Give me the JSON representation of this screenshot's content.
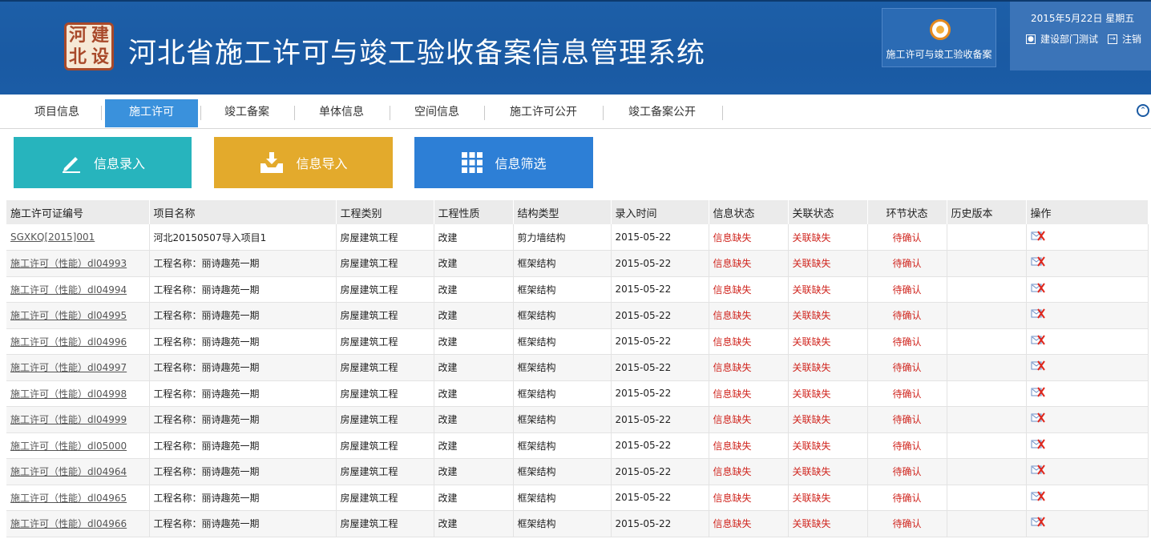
{
  "header": {
    "logo_seal_chars": [
      "河",
      "建",
      "北",
      "设"
    ],
    "title": "河北省施工许可与竣工验收备案信息管理系统",
    "module_label": "施工许可与竣工验收备案",
    "date": "2015年5月22日 星期五",
    "user": "建设部门测试",
    "logout": "注销"
  },
  "nav": {
    "items": [
      "项目信息",
      "施工许可",
      "竣工备案",
      "单体信息",
      "空间信息",
      "施工许可公开",
      "竣工备案公开"
    ],
    "active_index": 1
  },
  "actions": {
    "entry": "信息录入",
    "import": "信息导入",
    "filter": "信息筛选"
  },
  "table": {
    "headers": [
      "施工许可证编号",
      "项目名称",
      "工程类别",
      "工程性质",
      "结构类型",
      "录入时间",
      "信息状态",
      "关联状态",
      "环节状态",
      "历史版本",
      "操作"
    ],
    "rows": [
      [
        "SGXKQ[2015]001",
        "河北20150507导入项目1",
        "房屋建筑工程",
        "改建",
        "剪力墙结构",
        "2015-05-22",
        "信息缺失",
        "关联缺失",
        "待确认",
        ""
      ],
      [
        "施工许可（性能）dl04993",
        "工程名称：丽诗趣苑一期",
        "房屋建筑工程",
        "改建",
        "框架结构",
        "2015-05-22",
        "信息缺失",
        "关联缺失",
        "待确认",
        ""
      ],
      [
        "施工许可（性能）dl04994",
        "工程名称：丽诗趣苑一期",
        "房屋建筑工程",
        "改建",
        "框架结构",
        "2015-05-22",
        "信息缺失",
        "关联缺失",
        "待确认",
        ""
      ],
      [
        "施工许可（性能）dl04995",
        "工程名称：丽诗趣苑一期",
        "房屋建筑工程",
        "改建",
        "框架结构",
        "2015-05-22",
        "信息缺失",
        "关联缺失",
        "待确认",
        ""
      ],
      [
        "施工许可（性能）dl04996",
        "工程名称：丽诗趣苑一期",
        "房屋建筑工程",
        "改建",
        "框架结构",
        "2015-05-22",
        "信息缺失",
        "关联缺失",
        "待确认",
        ""
      ],
      [
        "施工许可（性能）dl04997",
        "工程名称：丽诗趣苑一期",
        "房屋建筑工程",
        "改建",
        "框架结构",
        "2015-05-22",
        "信息缺失",
        "关联缺失",
        "待确认",
        ""
      ],
      [
        "施工许可（性能）dl04998",
        "工程名称：丽诗趣苑一期",
        "房屋建筑工程",
        "改建",
        "框架结构",
        "2015-05-22",
        "信息缺失",
        "关联缺失",
        "待确认",
        ""
      ],
      [
        "施工许可（性能）dl04999",
        "工程名称：丽诗趣苑一期",
        "房屋建筑工程",
        "改建",
        "框架结构",
        "2015-05-22",
        "信息缺失",
        "关联缺失",
        "待确认",
        ""
      ],
      [
        "施工许可（性能）dl05000",
        "工程名称：丽诗趣苑一期",
        "房屋建筑工程",
        "改建",
        "框架结构",
        "2015-05-22",
        "信息缺失",
        "关联缺失",
        "待确认",
        ""
      ],
      [
        "施工许可（性能）dl04964",
        "工程名称：丽诗趣苑一期",
        "房屋建筑工程",
        "改建",
        "框架结构",
        "2015-05-22",
        "信息缺失",
        "关联缺失",
        "待确认",
        ""
      ],
      [
        "施工许可（性能）dl04965",
        "工程名称：丽诗趣苑一期",
        "房屋建筑工程",
        "改建",
        "框架结构",
        "2015-05-22",
        "信息缺失",
        "关联缺失",
        "待确认",
        ""
      ],
      [
        "施工许可（性能）dl04966",
        "工程名称：丽诗趣苑一期",
        "房屋建筑工程",
        "改建",
        "框架结构",
        "2015-05-22",
        "信息缺失",
        "关联缺失",
        "待确认",
        ""
      ]
    ]
  },
  "colors": {
    "header_bg": "#1a5aa3",
    "nav_active": "#3a91dc",
    "btn_entry": "#27b4bd",
    "btn_import": "#e3aa2c",
    "btn_filter": "#2d7fd6",
    "status_red": "#d0261f"
  }
}
